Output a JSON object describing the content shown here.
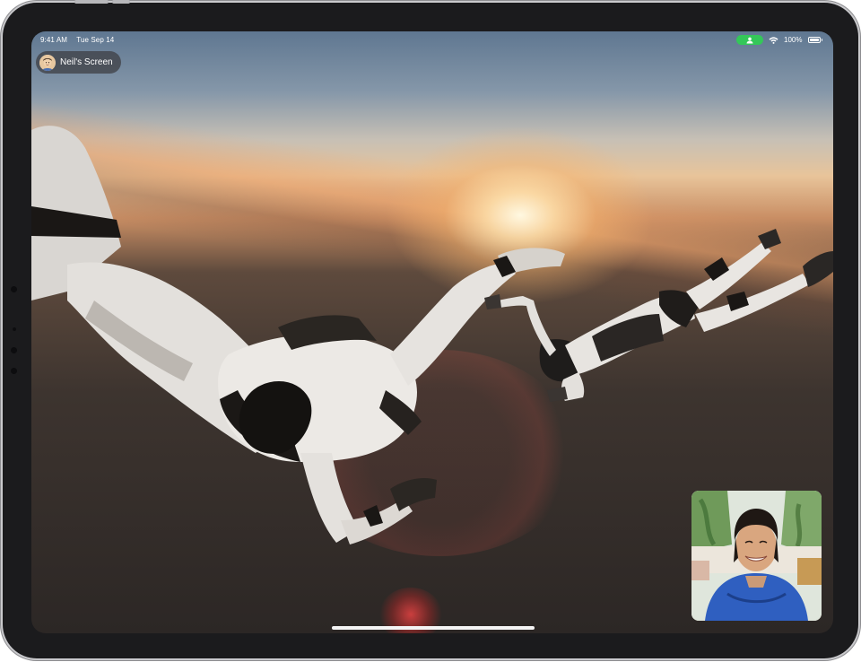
{
  "status_bar": {
    "time": "9:41 AM",
    "date": "Tue Sep 14",
    "battery_percent": "100%",
    "shareplay_color": "#34c759",
    "icons": [
      "shareplay-person-icon",
      "wifi-icon",
      "battery-icon"
    ]
  },
  "screen_share": {
    "label": "Neil's Screen",
    "avatar_icon": "memoji-avatar-icon"
  },
  "pip": {
    "icon": "facetime-self-view"
  },
  "home_indicator": {
    "icon": "home-indicator-bar"
  }
}
